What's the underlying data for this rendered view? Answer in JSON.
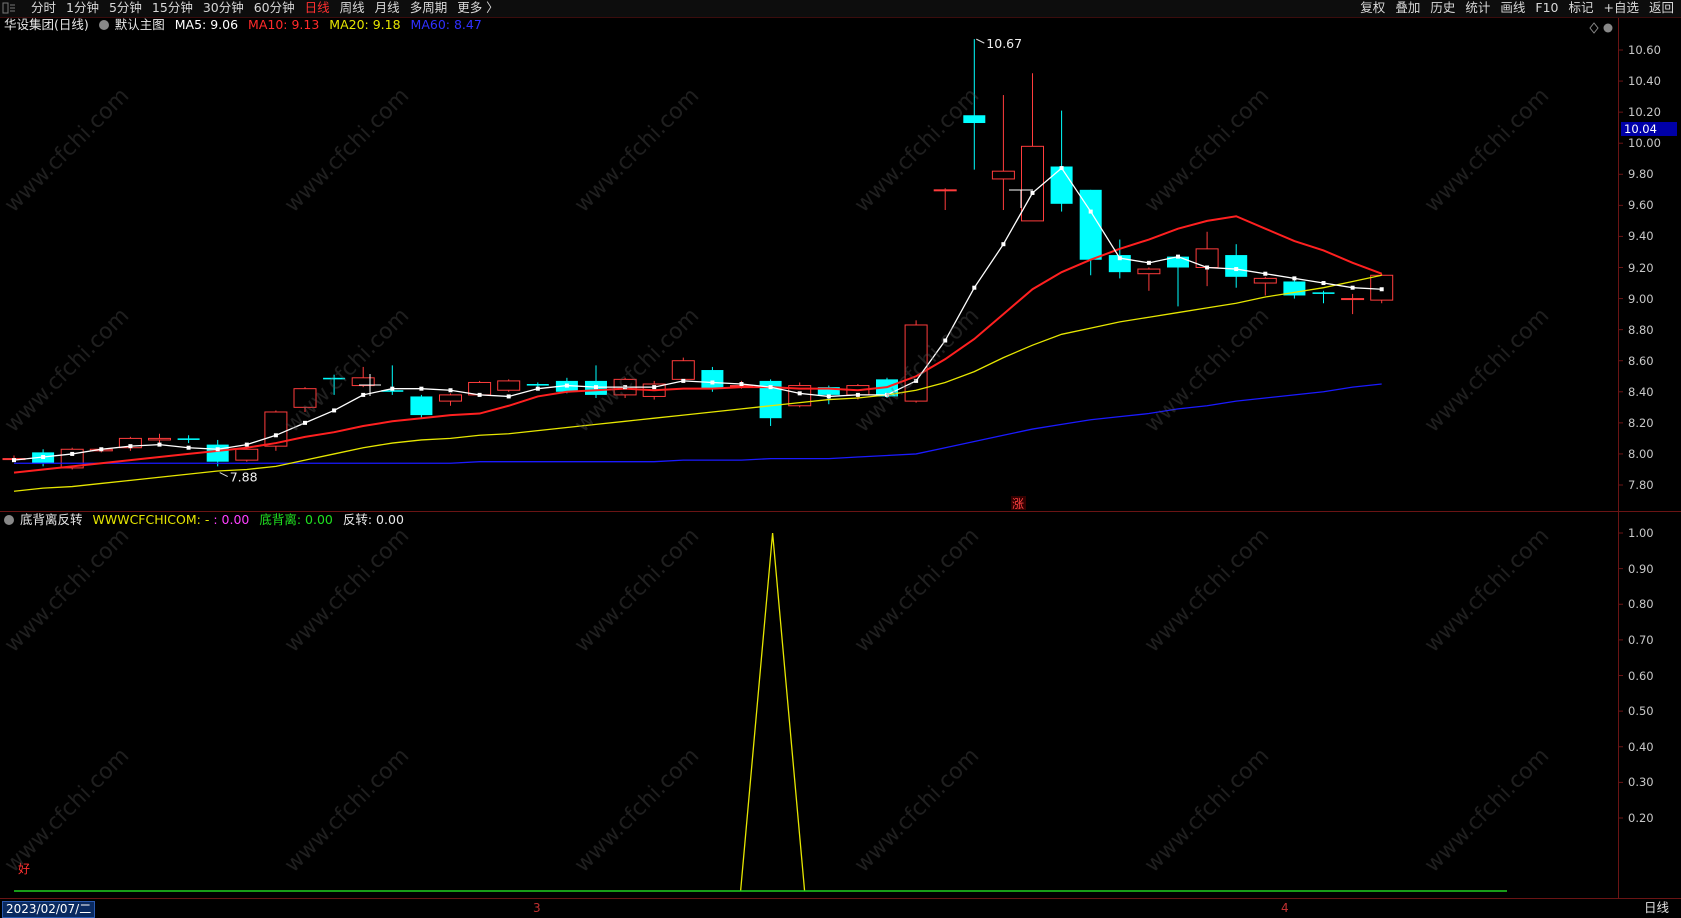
{
  "topbar": {
    "periods": [
      "分时",
      "1分钟",
      "5分钟",
      "15分钟",
      "30分钟",
      "60分钟",
      "日线",
      "周线",
      "月线",
      "多周期",
      "更多 〉"
    ],
    "active_period": "日线",
    "tools": [
      "复权",
      "叠加",
      "历史",
      "统计",
      "画线",
      "F10",
      "标记",
      "+自选",
      "返回"
    ]
  },
  "main_panel": {
    "stock_name": "华设集团(日线)",
    "template": "默认主图",
    "ma5_label": "MA5: 9.06",
    "ma10_label": "MA10: 9.13",
    "ma20_label": "MA20: 9.18",
    "ma60_label": "MA60: 8.47",
    "high_mark": "10.67",
    "low_mark": "7.88",
    "last_price_tag": "10.04",
    "limit_up_badge": "涨",
    "y_ticks": [
      "10.60",
      "10.40",
      "10.20",
      "10.00",
      "9.80",
      "9.60",
      "9.40",
      "9.20",
      "9.00",
      "8.80",
      "8.60",
      "8.40",
      "8.20",
      "8.00",
      "7.80"
    ],
    "colors": {
      "up": "#ff3c3c",
      "down": "#00ffff",
      "ma5": "#ffffff",
      "ma10": "#ff2020",
      "ma20": "#e6e600",
      "ma60": "#1a1aff"
    }
  },
  "indicator_panel": {
    "name": "底背离反转",
    "line1": "WWWCFCHICOM: -",
    "line2": ": 0.00",
    "line3": "底背离: 0.00",
    "line4": "反转: 0.00",
    "signal_label": "好",
    "y_ticks": [
      "1.00",
      "0.90",
      "0.80",
      "0.70",
      "0.60",
      "0.50",
      "0.40",
      "0.30",
      "0.20"
    ]
  },
  "bottombar": {
    "cursor_date": "2023/02/07/二",
    "month_labels": [
      "3",
      "4"
    ],
    "period": "日线"
  },
  "watermark": "www.cfchi.com",
  "chart_data": {
    "type": "candlestick",
    "ylim": [
      7.7,
      10.7
    ],
    "candles": [
      [
        7.97,
        7.97,
        7.95,
        7.99
      ],
      [
        8.01,
        7.94,
        7.92,
        8.03
      ],
      [
        7.91,
        8.03,
        7.9,
        8.04
      ],
      [
        8.02,
        8.03,
        8.01,
        8.04
      ],
      [
        8.04,
        8.1,
        8.02,
        8.11
      ],
      [
        8.09,
        8.1,
        8.05,
        8.13
      ],
      [
        8.1,
        8.09,
        8.07,
        8.12
      ],
      [
        8.06,
        7.95,
        7.92,
        8.09
      ],
      [
        7.96,
        8.03,
        7.95,
        8.07
      ],
      [
        8.05,
        8.27,
        8.02,
        8.28
      ],
      [
        8.3,
        8.42,
        8.27,
        8.43
      ],
      [
        8.49,
        8.48,
        8.38,
        8.51
      ],
      [
        8.44,
        8.49,
        8.43,
        8.56
      ],
      [
        8.41,
        8.4,
        8.38,
        8.57
      ],
      [
        8.37,
        8.25,
        8.23,
        8.38
      ],
      [
        8.34,
        8.38,
        8.31,
        8.39
      ],
      [
        8.38,
        8.46,
        8.37,
        8.47
      ],
      [
        8.41,
        8.47,
        8.4,
        8.48
      ],
      [
        8.45,
        8.44,
        8.42,
        8.46
      ],
      [
        8.47,
        8.4,
        8.39,
        8.49
      ],
      [
        8.47,
        8.38,
        8.36,
        8.57
      ],
      [
        8.38,
        8.48,
        8.36,
        8.49
      ],
      [
        8.37,
        8.45,
        8.35,
        8.47
      ],
      [
        8.48,
        8.6,
        8.46,
        8.62
      ],
      [
        8.54,
        8.42,
        8.4,
        8.56
      ],
      [
        8.44,
        8.44,
        8.42,
        8.47
      ],
      [
        8.47,
        8.23,
        8.18,
        8.48
      ],
      [
        8.31,
        8.44,
        8.3,
        8.46
      ],
      [
        8.43,
        8.38,
        8.32,
        8.44
      ],
      [
        8.38,
        8.44,
        8.35,
        8.45
      ],
      [
        8.48,
        8.37,
        8.36,
        8.49
      ],
      [
        8.34,
        8.83,
        8.33,
        8.86
      ],
      [
        9.7,
        9.7,
        9.57,
        9.71
      ],
      [
        10.18,
        10.13,
        9.83,
        10.67
      ],
      [
        9.77,
        9.82,
        9.57,
        10.31
      ],
      [
        9.5,
        9.98,
        9.5,
        10.45
      ],
      [
        9.85,
        9.61,
        9.56,
        10.21
      ],
      [
        9.7,
        9.25,
        9.15,
        9.7
      ],
      [
        9.28,
        9.17,
        9.13,
        9.38
      ],
      [
        9.16,
        9.19,
        9.05,
        9.2
      ],
      [
        9.27,
        9.2,
        8.95,
        9.27
      ],
      [
        9.2,
        9.32,
        9.08,
        9.43
      ],
      [
        9.28,
        9.14,
        9.07,
        9.35
      ],
      [
        9.1,
        9.13,
        9.02,
        9.14
      ],
      [
        9.11,
        9.02,
        9.0,
        9.12
      ],
      [
        9.04,
        9.03,
        8.97,
        9.05
      ],
      [
        9.0,
        9.0,
        8.9,
        9.03
      ],
      [
        8.99,
        9.15,
        8.97,
        9.16
      ]
    ],
    "ma5": [
      7.96,
      7.98,
      8.0,
      8.03,
      8.05,
      8.06,
      8.04,
      8.03,
      8.06,
      8.12,
      8.2,
      8.28,
      8.38,
      8.42,
      8.42,
      8.41,
      8.38,
      8.37,
      8.42,
      8.44,
      8.43,
      8.43,
      8.43,
      8.47,
      8.46,
      8.45,
      8.43,
      8.39,
      8.37,
      8.38,
      8.38,
      8.47,
      8.73,
      9.07,
      9.35,
      9.68,
      9.84,
      9.56,
      9.26,
      9.23,
      9.27,
      9.2,
      9.19,
      9.16,
      9.13,
      9.1,
      9.07,
      9.06
    ],
    "ma10": [
      7.88,
      7.9,
      7.92,
      7.94,
      7.96,
      7.98,
      8.0,
      8.02,
      8.04,
      8.07,
      8.11,
      8.14,
      8.18,
      8.21,
      8.23,
      8.25,
      8.26,
      8.31,
      8.37,
      8.4,
      8.41,
      8.42,
      8.41,
      8.42,
      8.42,
      8.43,
      8.43,
      8.42,
      8.42,
      8.41,
      8.43,
      8.5,
      8.61,
      8.74,
      8.9,
      9.06,
      9.17,
      9.25,
      9.32,
      9.38,
      9.45,
      9.5,
      9.53,
      9.45,
      9.37,
      9.31,
      9.23,
      9.16
    ],
    "ma20": [
      7.76,
      7.78,
      7.79,
      7.81,
      7.83,
      7.85,
      7.87,
      7.89,
      7.9,
      7.92,
      7.96,
      8.0,
      8.04,
      8.07,
      8.09,
      8.1,
      8.12,
      8.13,
      8.15,
      8.17,
      8.19,
      8.21,
      8.23,
      8.25,
      8.27,
      8.29,
      8.31,
      8.33,
      8.35,
      8.36,
      8.38,
      8.41,
      8.46,
      8.53,
      8.62,
      8.7,
      8.77,
      8.81,
      8.85,
      8.88,
      8.91,
      8.94,
      8.97,
      9.01,
      9.04,
      9.07,
      9.11,
      9.15
    ],
    "ma60": [
      7.94,
      7.94,
      7.94,
      7.94,
      7.94,
      7.94,
      7.94,
      7.94,
      7.94,
      7.94,
      7.94,
      7.94,
      7.94,
      7.94,
      7.94,
      7.94,
      7.95,
      7.95,
      7.95,
      7.95,
      7.95,
      7.95,
      7.95,
      7.96,
      7.96,
      7.96,
      7.97,
      7.97,
      7.97,
      7.98,
      7.99,
      8.0,
      8.04,
      8.08,
      8.12,
      8.16,
      8.19,
      8.22,
      8.24,
      8.26,
      8.29,
      8.31,
      8.34,
      8.36,
      8.38,
      8.4,
      8.43,
      8.45
    ],
    "indicator_spike": {
      "x_index": 26,
      "value": 1.0
    }
  }
}
